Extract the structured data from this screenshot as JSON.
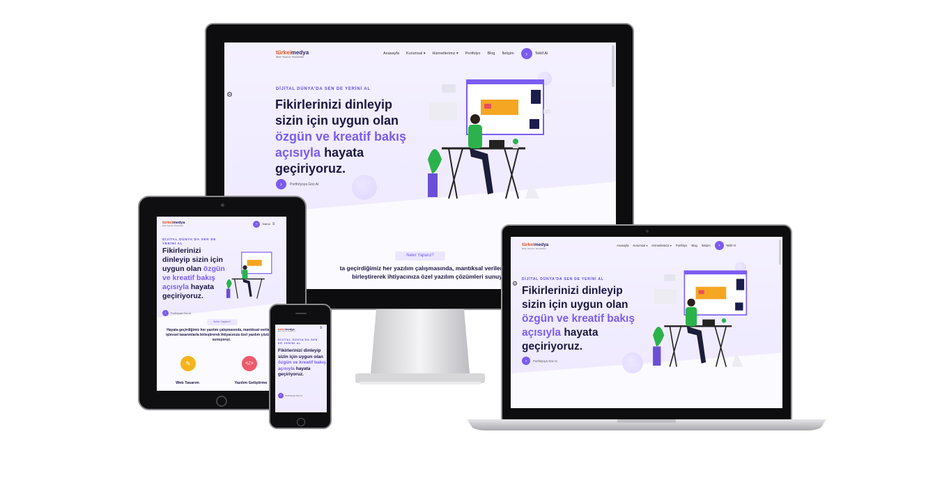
{
  "site": {
    "logo_brand": "türkei",
    "logo_brand2": "medya",
    "logo_tagline": "Web Yazılım Hizmetleri",
    "nav": [
      "Anasayfa",
      "Kurumsal",
      "Hizmetlerimiz",
      "Portfolyo",
      "Blog",
      "İletişim"
    ],
    "nav_cta": "Teklif Al",
    "kicker": "DİJİTAL DÜNYA'DA SEN DE YERİNİ AL",
    "headline_part1": "Fikirlerinizi dinleyip sizin için uygun olan",
    "headline_highlight": "özgün ve kreatif bakış açısıyla",
    "headline_part2": "hayata geçiriyoruz.",
    "portfolio_link": "Portfolyoya Göz At",
    "section_pill": "Neler Yaparız?",
    "section_text_line1": "ta geçirdiğimiz her yazılım çalışmasında, mantıksal verileri ve işlev",
    "section_text_line2": "birleştirerek ihtiyacınıza özel yazılım çözümleri sunuyoruz",
    "tablet_section_text": "Hayata geçirdiğimiz her yazılım çalışmasında, mantıksal verileri ve işlevsel tasarımlarla birleştirerek ihtiyacınıza özel yazılım çözümleri sunuyoruz.",
    "services": [
      "Web Tasarım",
      "Yazılım Geliştirme"
    ]
  },
  "colors": {
    "accent": "#7b5cf0",
    "headline": "#1b1740",
    "brand_orange": "#d9531e",
    "hero_bg": "#f1edff",
    "bezel": "#0d0d0f"
  },
  "icons": [
    "gear-icon",
    "chevron-right-icon",
    "hamburger-icon",
    "web-design-icon",
    "code-icon",
    "apple-logo-icon"
  ]
}
